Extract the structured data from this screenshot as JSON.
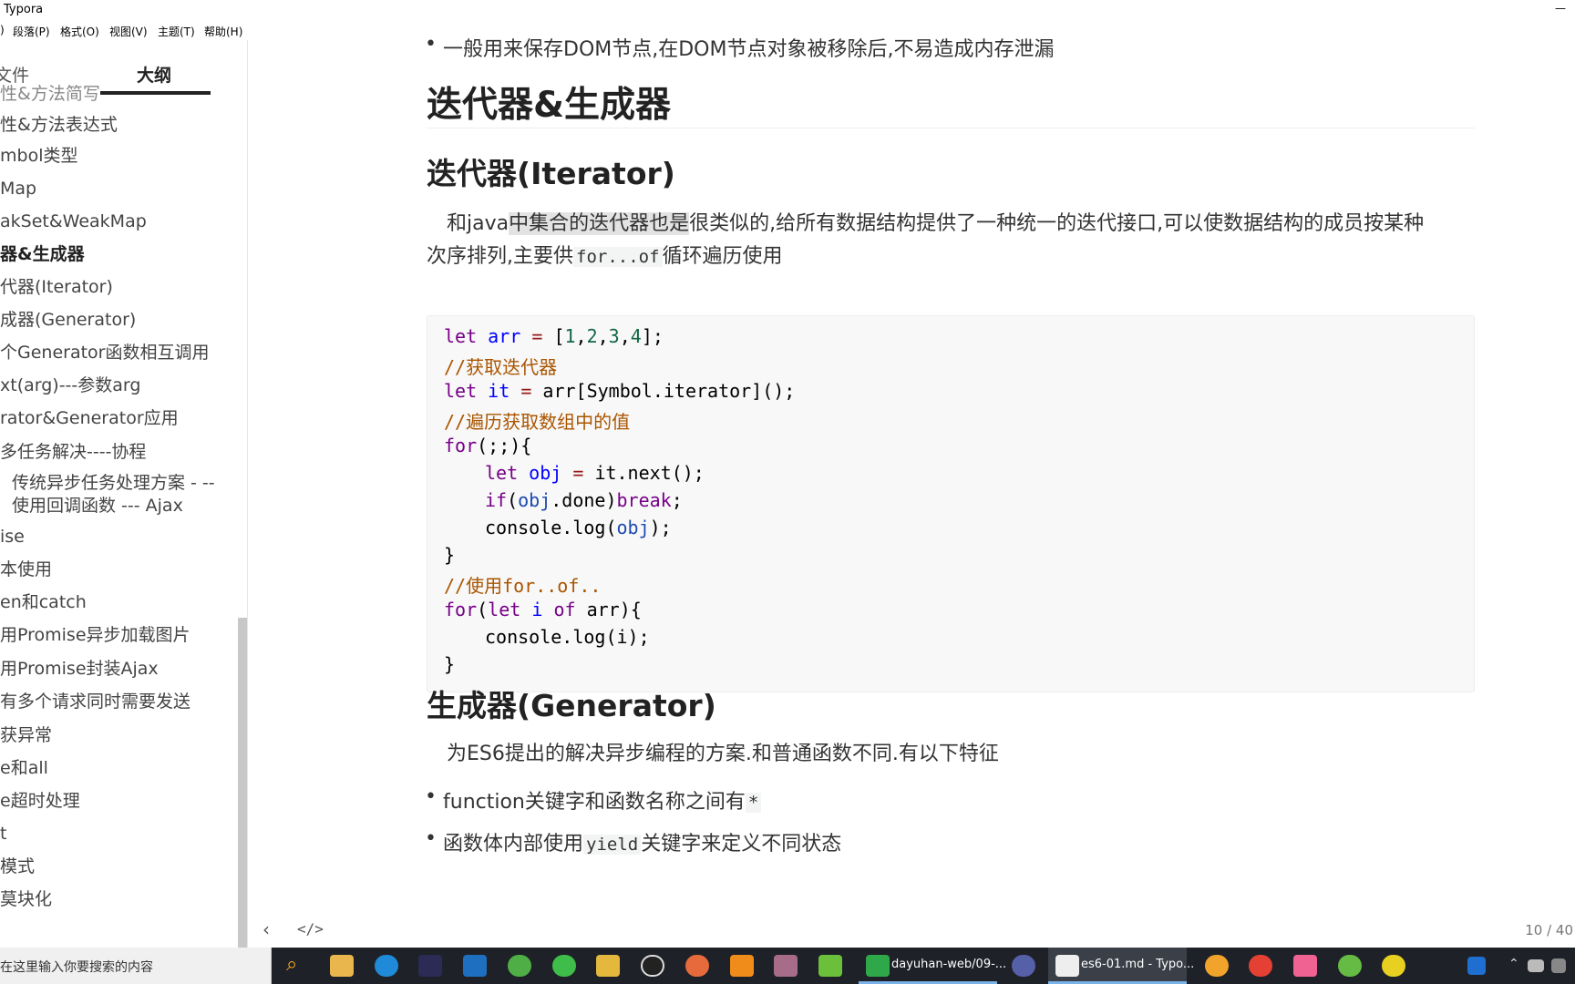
{
  "window": {
    "title": "Typora",
    "minimize_glyph": "—"
  },
  "menu": [
    ")",
    "段落(P)",
    "格式(O)",
    "视图(V)",
    "主题(T)",
    "帮助(H)"
  ],
  "sidebar": {
    "tab_files": "文件",
    "tab_outline": "大纲",
    "items": [
      "性&方法表达式",
      "mbol类型",
      "Map",
      "akSet&WeakMap",
      "器&生成器",
      "代器(Iterator)",
      "成器(Generator)",
      "个Generator函数相互调用",
      "xt(arg)---参数arg",
      "rator&Generator应用",
      "多任务解决----协程",
      "传统异步任务处理方案 - -- 使用回调函数 --- Ajax",
      "ise",
      "本使用",
      "en和catch",
      "用Promise异步加载图片",
      "用Promise封装Ajax",
      "有多个请求同时需要发送",
      "获异常",
      "e和all",
      "e超时处理",
      "t",
      "模式",
      "莫块化"
    ],
    "top_partial": "性&方法简写"
  },
  "doc": {
    "bullet_top": "一般用来保存DOM节点,在DOM节点对象被移除后,不易造成内存泄漏",
    "h2": "迭代器&生成器",
    "h3_iterator": "迭代器(Iterator)",
    "para_iter_a": "和java",
    "para_iter_hl": "中集合的迭代器也是",
    "para_iter_b": "很类似的,给所有数据结构提供了一种统一的迭代接口,可以使数据结构的成员按某种",
    "para_iter_c": "次序排列,主要供",
    "para_iter_code": "for...of",
    "para_iter_d": "循环遍历使用",
    "h3_generator": "生成器(Generator)",
    "para_gen": "为ES6提出的解决异步编程的方案.和普通函数不同.有以下特征",
    "bullet_gen_1a": "function关键字和函数名称之间有",
    "bullet_gen_1code": "*",
    "bullet_gen_2a": "函数体内部使用",
    "bullet_gen_2code": "yield",
    "bullet_gen_2b": "关键字来定义不同状态"
  },
  "code": {
    "l1_kw": "let",
    "l1_var": "arr",
    "l1_eq": "=",
    "l1_a": "[",
    "l1_n1": "1",
    "l1_n2": "2",
    "l1_n3": "3",
    "l1_n4": "4",
    "l1_b": "];",
    "l2": "//获取迭代器",
    "l3_kw": "let",
    "l3_var": "it",
    "l3_eq": "=",
    "l3_rest": "arr[Symbol.iterator]();",
    "l4": "//遍历获取数组中的值",
    "l5_kw": "for",
    "l5_rest": "(;;){",
    "l6_kw": "let",
    "l6_var": "obj",
    "l6_eq": "=",
    "l6_rest": "it.next();",
    "l7_kw": "if",
    "l7_a": "(",
    "l7_var": "obj",
    "l7_b": ".done)",
    "l7_kw2": "break",
    "l7_c": ";",
    "l8_a": "console.log(",
    "l8_var": "obj",
    "l8_b": ");",
    "l9": "}",
    "l10_cm": "//使用",
    "l10_rest": "for..of..",
    "l11_kw": "for",
    "l11_a": "(",
    "l11_kw2": "let",
    "l11_var": "i",
    "l11_kw3": "of",
    "l11_b": "arr){",
    "l12": "console.log(i);",
    "l13": "}"
  },
  "footer": {
    "back": "‹",
    "source": "</>",
    "count": "10 / 40"
  },
  "taskbar": {
    "search_placeholder": "在这里输入你要搜索的内容",
    "item1": "dayuhan-web/09-...",
    "item2": "es6-01.md - Typo..."
  },
  "colors": {
    "accent": "#7ab3e8",
    "taskbar": "#1e2127"
  }
}
